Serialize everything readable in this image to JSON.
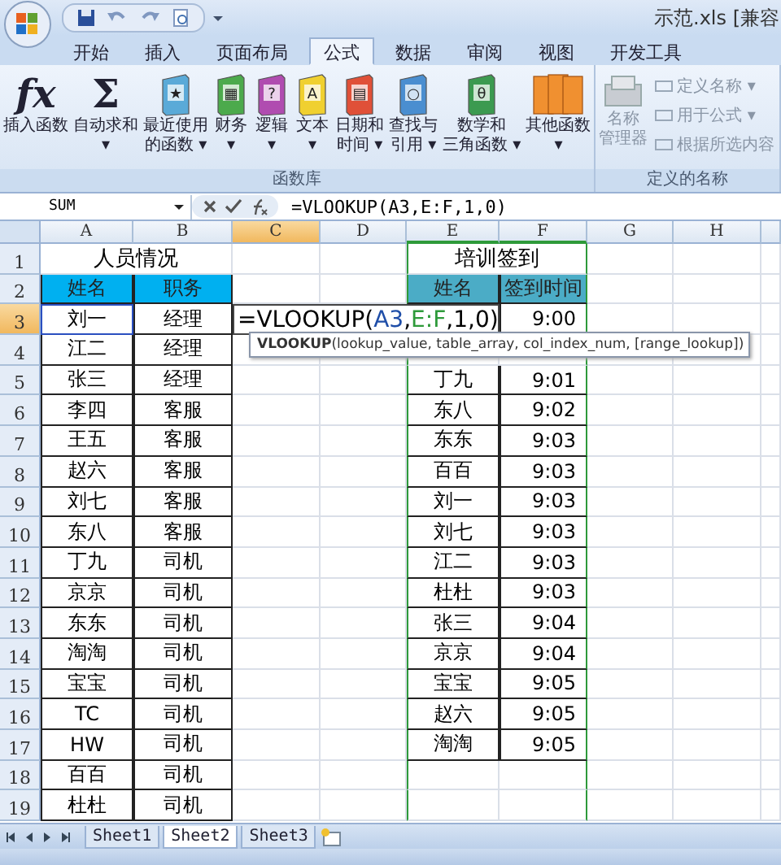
{
  "window": {
    "title": "示范.xls  [兼容"
  },
  "ribbon_tabs": [
    {
      "label": "开始",
      "selected": false
    },
    {
      "label": "插入",
      "selected": false
    },
    {
      "label": "页面布局",
      "selected": false
    },
    {
      "label": "公式",
      "selected": true
    },
    {
      "label": "数据",
      "selected": false
    },
    {
      "label": "审阅",
      "selected": false
    },
    {
      "label": "视图",
      "selected": false
    },
    {
      "label": "开发工具",
      "selected": false
    }
  ],
  "ribbon_groups": [
    {
      "title": "函数库",
      "disabled": false,
      "buttons": [
        {
          "kind": "glyph",
          "glyph": "fx",
          "lines": [
            "插入函数"
          ]
        },
        {
          "kind": "glyph",
          "glyph": "Σ",
          "lines": [
            "自动求和",
            "▾"
          ]
        },
        {
          "kind": "book",
          "color": "#5aaad8",
          "glyph": "★",
          "lines": [
            "最近使用",
            "的函数 ▾"
          ]
        },
        {
          "kind": "book",
          "color": "#4caa4c",
          "glyph": "▦",
          "lines": [
            "财务",
            "▾"
          ]
        },
        {
          "kind": "book",
          "color": "#b04cb0",
          "glyph": "?",
          "lines": [
            "逻辑",
            "▾"
          ]
        },
        {
          "kind": "book",
          "color": "#f0d030",
          "glyph": "A",
          "lines": [
            "文本",
            "▾"
          ]
        },
        {
          "kind": "book",
          "color": "#e05038",
          "glyph": "▤",
          "lines": [
            "日期和",
            "时间 ▾"
          ]
        },
        {
          "kind": "book",
          "color": "#4a8ed0",
          "glyph": "○",
          "lines": [
            "查找与",
            "引用 ▾"
          ]
        },
        {
          "kind": "book",
          "color": "#3c9a50",
          "glyph": "θ",
          "lines": [
            "数学和",
            "三角函数 ▾"
          ]
        },
        {
          "kind": "books",
          "color": "#f09030",
          "lines": [
            "其他函数",
            "▾"
          ]
        }
      ]
    },
    {
      "title": "定义的名称",
      "disabled": true,
      "buttons": [
        {
          "kind": "large",
          "lines": [
            "名称",
            "管理器"
          ]
        },
        {
          "kind": "small",
          "lines": [
            "定义名称 ▾"
          ]
        },
        {
          "kind": "small",
          "lines": [
            "用于公式 ▾"
          ]
        },
        {
          "kind": "small",
          "lines": [
            "根据所选内容"
          ]
        }
      ]
    }
  ],
  "formula_bar": {
    "name_box": "SUM",
    "formula": "=VLOOKUP(A3,E:F,1,0)"
  },
  "sheet": {
    "columns": [
      {
        "label": "A",
        "selected": false,
        "referenced": false
      },
      {
        "label": "B",
        "selected": false,
        "referenced": false
      },
      {
        "label": "C",
        "selected": true,
        "referenced": false
      },
      {
        "label": "D",
        "selected": false,
        "referenced": false
      },
      {
        "label": "E",
        "selected": false,
        "referenced": true
      },
      {
        "label": "F",
        "selected": false,
        "referenced": true
      },
      {
        "label": "G",
        "selected": false,
        "referenced": false
      },
      {
        "label": "H",
        "selected": false,
        "referenced": false
      }
    ],
    "rows": [
      {
        "label": "1",
        "selected": false,
        "cells": [
          {
            "kind": "title",
            "text": "人员情况"
          },
          {
            "kind": "covered"
          },
          {
            "kind": "empty"
          },
          {
            "kind": "empty"
          },
          {
            "kind": "title",
            "text": "培训签到"
          },
          {
            "kind": "covered"
          },
          {
            "kind": "empty"
          },
          {
            "kind": "empty"
          }
        ]
      },
      {
        "label": "2",
        "selected": false,
        "cells": [
          {
            "kind": "head",
            "text": "姓名",
            "color": "#00b0f0"
          },
          {
            "kind": "head",
            "text": "职务",
            "color": "#00b0f0"
          },
          {
            "kind": "empty"
          },
          {
            "kind": "empty"
          },
          {
            "kind": "head",
            "text": "姓名",
            "color": "#4bacc6"
          },
          {
            "kind": "head",
            "text": "签到时间",
            "color": "#4bacc6"
          },
          {
            "kind": "empty"
          },
          {
            "kind": "empty"
          }
        ]
      },
      {
        "label": "3",
        "selected": true,
        "cells": [
          {
            "kind": "ref-name",
            "text": "刘一"
          },
          {
            "kind": "name",
            "text": "经理"
          },
          {
            "kind": "editing",
            "parts": [
              {
                "text": "=VLOOKUP(",
                "color": "#000000"
              },
              {
                "text": "A3",
                "color": "#1f4ea8"
              },
              {
                "text": ",",
                "color": "#000000"
              },
              {
                "text": "E:F",
                "color": "#2e9a3a"
              },
              {
                "text": ",1,0)",
                "color": "#000000"
              }
            ]
          },
          {
            "kind": "covered"
          },
          {
            "kind": "covered"
          },
          {
            "kind": "time",
            "text": "9:00"
          },
          {
            "kind": "empty"
          },
          {
            "kind": "empty"
          }
        ]
      },
      {
        "label": "4",
        "selected": false,
        "cells": [
          {
            "kind": "name",
            "text": "江二"
          },
          {
            "kind": "name",
            "text": "经理"
          },
          {
            "kind": "empty"
          },
          {
            "kind": "empty"
          },
          {
            "kind": "empty"
          },
          {
            "kind": "empty"
          },
          {
            "kind": "empty"
          },
          {
            "kind": "empty"
          }
        ]
      },
      {
        "label": "5",
        "selected": false,
        "cells": [
          {
            "kind": "name",
            "text": "张三"
          },
          {
            "kind": "name",
            "text": "经理"
          },
          {
            "kind": "empty"
          },
          {
            "kind": "empty"
          },
          {
            "kind": "name",
            "text": "丁九"
          },
          {
            "kind": "time",
            "text": "9:01"
          },
          {
            "kind": "empty"
          },
          {
            "kind": "empty"
          }
        ]
      },
      {
        "label": "6",
        "selected": false,
        "cells": [
          {
            "kind": "name",
            "text": "李四"
          },
          {
            "kind": "name",
            "text": "客服"
          },
          {
            "kind": "empty"
          },
          {
            "kind": "empty"
          },
          {
            "kind": "name",
            "text": "东八"
          },
          {
            "kind": "time",
            "text": "9:02"
          },
          {
            "kind": "empty"
          },
          {
            "kind": "empty"
          }
        ]
      },
      {
        "label": "7",
        "selected": false,
        "cells": [
          {
            "kind": "name",
            "text": "王五"
          },
          {
            "kind": "name",
            "text": "客服"
          },
          {
            "kind": "empty"
          },
          {
            "kind": "empty"
          },
          {
            "kind": "name",
            "text": "东东"
          },
          {
            "kind": "time",
            "text": "9:03"
          },
          {
            "kind": "empty"
          },
          {
            "kind": "empty"
          }
        ]
      },
      {
        "label": "8",
        "selected": false,
        "cells": [
          {
            "kind": "name",
            "text": "赵六"
          },
          {
            "kind": "name",
            "text": "客服"
          },
          {
            "kind": "empty"
          },
          {
            "kind": "empty"
          },
          {
            "kind": "name",
            "text": "百百"
          },
          {
            "kind": "time",
            "text": "9:03"
          },
          {
            "kind": "empty"
          },
          {
            "kind": "empty"
          }
        ]
      },
      {
        "label": "9",
        "selected": false,
        "cells": [
          {
            "kind": "name",
            "text": "刘七"
          },
          {
            "kind": "name",
            "text": "客服"
          },
          {
            "kind": "empty"
          },
          {
            "kind": "empty"
          },
          {
            "kind": "name",
            "text": "刘一"
          },
          {
            "kind": "time",
            "text": "9:03"
          },
          {
            "kind": "empty"
          },
          {
            "kind": "empty"
          }
        ]
      },
      {
        "label": "10",
        "selected": false,
        "cells": [
          {
            "kind": "name",
            "text": "东八"
          },
          {
            "kind": "name",
            "text": "客服"
          },
          {
            "kind": "empty"
          },
          {
            "kind": "empty"
          },
          {
            "kind": "name",
            "text": "刘七"
          },
          {
            "kind": "time",
            "text": "9:03"
          },
          {
            "kind": "empty"
          },
          {
            "kind": "empty"
          }
        ]
      },
      {
        "label": "11",
        "selected": false,
        "cells": [
          {
            "kind": "name",
            "text": "丁九"
          },
          {
            "kind": "name",
            "text": "司机"
          },
          {
            "kind": "empty"
          },
          {
            "kind": "empty"
          },
          {
            "kind": "name",
            "text": "江二"
          },
          {
            "kind": "time",
            "text": "9:03"
          },
          {
            "kind": "empty"
          },
          {
            "kind": "empty"
          }
        ]
      },
      {
        "label": "12",
        "selected": false,
        "cells": [
          {
            "kind": "name",
            "text": "京京"
          },
          {
            "kind": "name",
            "text": "司机"
          },
          {
            "kind": "empty"
          },
          {
            "kind": "empty"
          },
          {
            "kind": "name",
            "text": "杜杜"
          },
          {
            "kind": "time",
            "text": "9:03"
          },
          {
            "kind": "empty"
          },
          {
            "kind": "empty"
          }
        ]
      },
      {
        "label": "13",
        "selected": false,
        "cells": [
          {
            "kind": "name",
            "text": "东东"
          },
          {
            "kind": "name",
            "text": "司机"
          },
          {
            "kind": "empty"
          },
          {
            "kind": "empty"
          },
          {
            "kind": "name",
            "text": "张三"
          },
          {
            "kind": "time",
            "text": "9:04"
          },
          {
            "kind": "empty"
          },
          {
            "kind": "empty"
          }
        ]
      },
      {
        "label": "14",
        "selected": false,
        "cells": [
          {
            "kind": "name",
            "text": "淘淘"
          },
          {
            "kind": "name",
            "text": "司机"
          },
          {
            "kind": "empty"
          },
          {
            "kind": "empty"
          },
          {
            "kind": "name",
            "text": "京京"
          },
          {
            "kind": "time",
            "text": "9:04"
          },
          {
            "kind": "empty"
          },
          {
            "kind": "empty"
          }
        ]
      },
      {
        "label": "15",
        "selected": false,
        "cells": [
          {
            "kind": "name",
            "text": "宝宝"
          },
          {
            "kind": "name",
            "text": "司机"
          },
          {
            "kind": "empty"
          },
          {
            "kind": "empty"
          },
          {
            "kind": "name",
            "text": "宝宝"
          },
          {
            "kind": "time",
            "text": "9:05"
          },
          {
            "kind": "empty"
          },
          {
            "kind": "empty"
          }
        ]
      },
      {
        "label": "16",
        "selected": false,
        "cells": [
          {
            "kind": "name",
            "text": "TC"
          },
          {
            "kind": "name",
            "text": "司机"
          },
          {
            "kind": "empty"
          },
          {
            "kind": "empty"
          },
          {
            "kind": "name",
            "text": "赵六"
          },
          {
            "kind": "time",
            "text": "9:05"
          },
          {
            "kind": "empty"
          },
          {
            "kind": "empty"
          }
        ]
      },
      {
        "label": "17",
        "selected": false,
        "cells": [
          {
            "kind": "name",
            "text": "HW"
          },
          {
            "kind": "name",
            "text": "司机"
          },
          {
            "kind": "empty"
          },
          {
            "kind": "empty"
          },
          {
            "kind": "name",
            "text": "淘淘"
          },
          {
            "kind": "time",
            "text": "9:05"
          },
          {
            "kind": "empty"
          },
          {
            "kind": "empty"
          }
        ]
      },
      {
        "label": "18",
        "selected": false,
        "cells": [
          {
            "kind": "name",
            "text": "百百"
          },
          {
            "kind": "name",
            "text": "司机"
          },
          {
            "kind": "empty"
          },
          {
            "kind": "empty"
          },
          {
            "kind": "empty"
          },
          {
            "kind": "empty"
          },
          {
            "kind": "empty"
          },
          {
            "kind": "empty"
          }
        ]
      },
      {
        "label": "19",
        "selected": false,
        "cells": [
          {
            "kind": "name",
            "text": "杜杜"
          },
          {
            "kind": "name",
            "text": "司机"
          },
          {
            "kind": "empty"
          },
          {
            "kind": "empty"
          },
          {
            "kind": "empty"
          },
          {
            "kind": "empty"
          },
          {
            "kind": "empty"
          },
          {
            "kind": "empty"
          }
        ]
      }
    ],
    "tooltip": "**VLOOKUP**(lookup_value, table_array, col_index_num, [range_lookup])"
  },
  "sheet_tabs": [
    {
      "label": "Sheet1",
      "selected": false
    },
    {
      "label": "Sheet2",
      "selected": true
    },
    {
      "label": "Sheet3",
      "selected": false
    }
  ]
}
